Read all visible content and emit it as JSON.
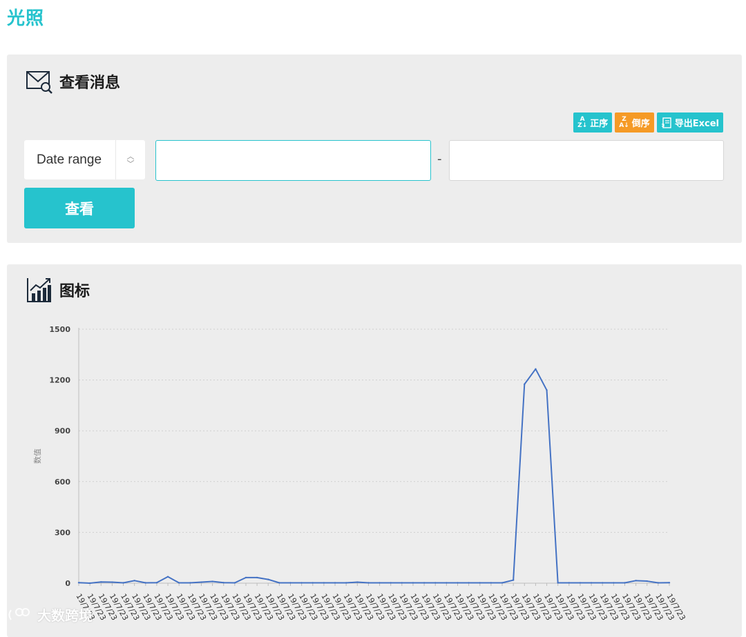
{
  "page": {
    "title": "光照"
  },
  "query_panel": {
    "title": "查看消息",
    "icon": "mail-search-icon",
    "sort_asc_label": "正序",
    "sort_desc_label": "倒序",
    "export_label": "导出Excel",
    "range_select_label": "Date range",
    "range_separator": "-",
    "start_value": "",
    "end_value": "",
    "view_button_label": "查看"
  },
  "chart_panel": {
    "title": "图标",
    "icon": "line-chart-icon"
  },
  "colors": {
    "accent": "#26c3cd",
    "sort_desc": "#f59a26",
    "series": "#4472c4",
    "panel_bg": "#ededed"
  },
  "chart_data": {
    "type": "line",
    "title": "",
    "xlabel": "",
    "ylabel": "数值",
    "ylim": [
      0,
      1500
    ],
    "yticks": [
      0,
      300,
      600,
      900,
      1200,
      1500
    ],
    "grid": true,
    "categories": [
      "19/7/23",
      "19/7/23",
      "19/7/23",
      "19/7/23",
      "19/7/23",
      "19/7/23",
      "19/7/23",
      "19/7/23",
      "19/7/23",
      "19/7/23",
      "19/7/23",
      "19/7/23",
      "19/7/23",
      "19/7/23",
      "19/7/23",
      "19/7/23",
      "19/7/23",
      "19/7/23",
      "19/7/23",
      "19/7/23",
      "19/7/23",
      "19/7/23",
      "19/7/23",
      "19/7/23",
      "19/7/23",
      "19/7/23",
      "19/7/23",
      "19/7/23",
      "19/7/23",
      "19/7/23",
      "19/7/23",
      "19/7/23",
      "19/7/23",
      "19/7/23",
      "19/7/23",
      "19/7/23",
      "19/7/23",
      "19/7/23",
      "19/7/23",
      "19/7/23",
      "19/7/23",
      "19/7/23",
      "19/7/23",
      "19/7/23",
      "19/7/23",
      "19/7/23",
      "19/7/23",
      "19/7/23",
      "19/7/23",
      "19/7/23",
      "19/7/23",
      "19/7/23",
      "19/7/23",
      "19/7/23"
    ],
    "series": [
      {
        "values": [
          3,
          0,
          7,
          6,
          2,
          15,
          2,
          3,
          38,
          2,
          2,
          6,
          10,
          3,
          2,
          33,
          33,
          22,
          2,
          2,
          2,
          2,
          2,
          2,
          2,
          6,
          2,
          2,
          2,
          2,
          2,
          2,
          2,
          2,
          2,
          2,
          2,
          2,
          2,
          18,
          1175,
          1265,
          1140,
          2,
          2,
          2,
          2,
          2,
          2,
          2,
          15,
          12,
          2,
          3
        ]
      }
    ]
  },
  "watermark": {
    "text": "大数跨境"
  }
}
